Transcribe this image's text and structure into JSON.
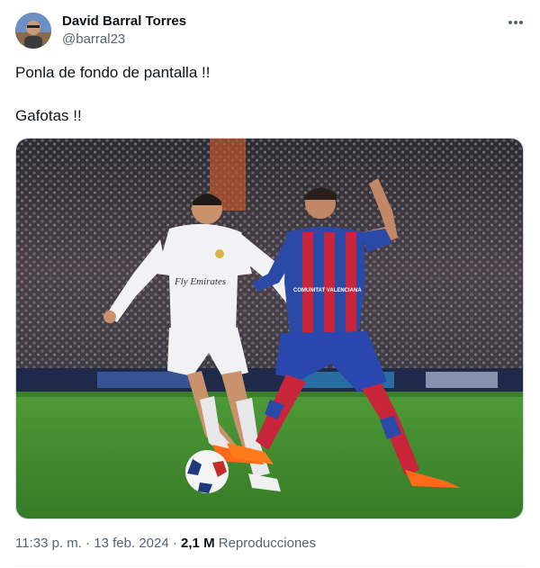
{
  "author": {
    "display_name": "David Barral Torres",
    "handle": "@barral23",
    "avatar_icon": "user-avatar-photo"
  },
  "more_icon": "more-horizontal-icon",
  "tweet": {
    "lines": [
      "Ponla de fondo de pantalla !!",
      "Gafotas !!"
    ]
  },
  "media": {
    "kind": "photo",
    "jersey_text_white": "Fly Emirates",
    "jersey_text_blue": "COMUNITAT VALENCIANA"
  },
  "meta": {
    "time": "11:33 p. m.",
    "separator": "·",
    "date": "13 feb. 2024",
    "views_count": "2,1 M",
    "views_label": "Reproducciones"
  },
  "colors": {
    "text_primary": "#0f1419",
    "text_secondary": "#536471",
    "pitch_green": "#3f8a2c",
    "levante_blue": "#2b4aa8",
    "levante_red": "#c8243a"
  }
}
